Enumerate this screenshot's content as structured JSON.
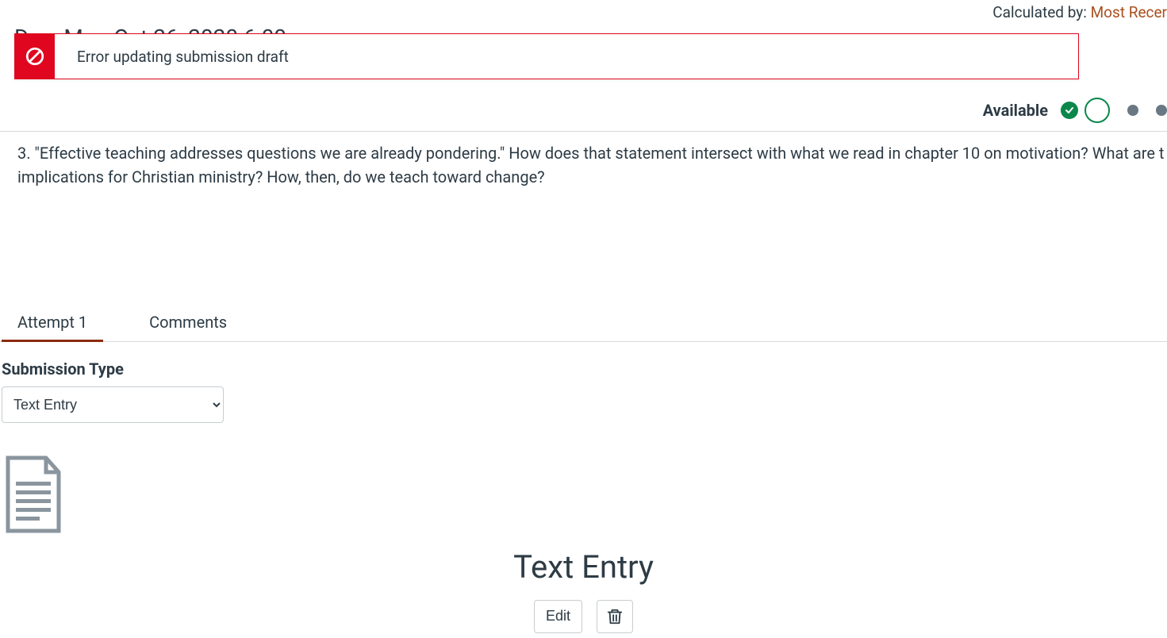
{
  "header": {
    "calculated_label": "Calculated by: ",
    "calculated_link": "Most Recer",
    "due_text": "Due: Mon Oct 26, 2020 6:00pm"
  },
  "alert": {
    "message": "Error updating submission draft"
  },
  "status_row": {
    "available_label": "Available"
  },
  "question": {
    "text": "3. \"Effective teaching addresses questions we are already pondering.\" How does that statement intersect with what we read in chapter 10 on motivation? What are t implications for Christian ministry? How, then, do we teach toward change?"
  },
  "tabs": {
    "attempt": "Attempt 1",
    "comments": "Comments"
  },
  "submission": {
    "type_label": "Submission Type",
    "selected": "Text Entry"
  },
  "entry_panel": {
    "title": "Text Entry",
    "edit": "Edit"
  }
}
